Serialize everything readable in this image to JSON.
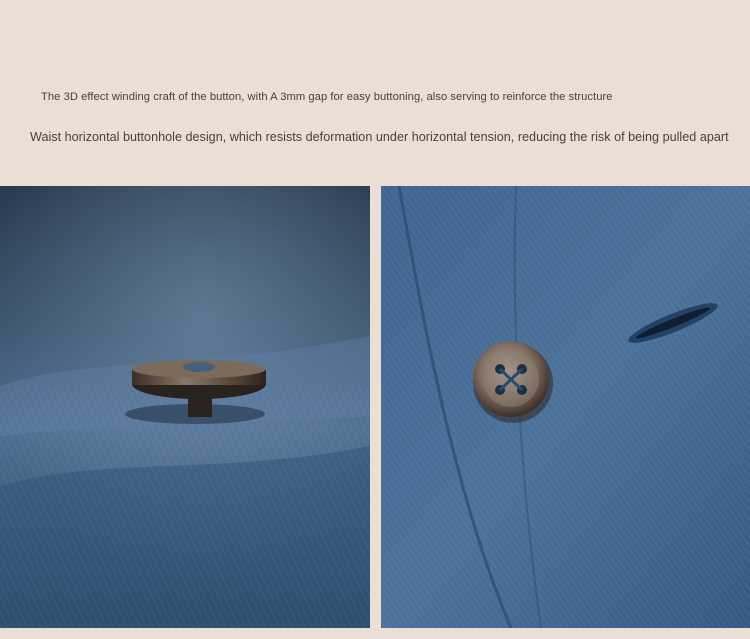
{
  "captions": {
    "line1": "The 3D effect winding craft of the button, with A 3mm gap for easy buttoning, also serving to reinforce the structure",
    "line2": "Waist horizontal buttonhole design, which resists deformation under horizontal tension, reducing the risk of being pulled apart"
  },
  "colors": {
    "background": "#e9dfd4",
    "caption_text": "#4a4038",
    "denim_dark": "#1f3550",
    "denim_mid": "#3d6288",
    "denim_light": "#6e8fae",
    "button_shell": "#6b5a4c"
  },
  "photos": [
    {
      "subject": "denim-fabric-with-raised-shank-button"
    },
    {
      "subject": "denim-placket-with-four-hole-button-and-buttonhole"
    }
  ]
}
